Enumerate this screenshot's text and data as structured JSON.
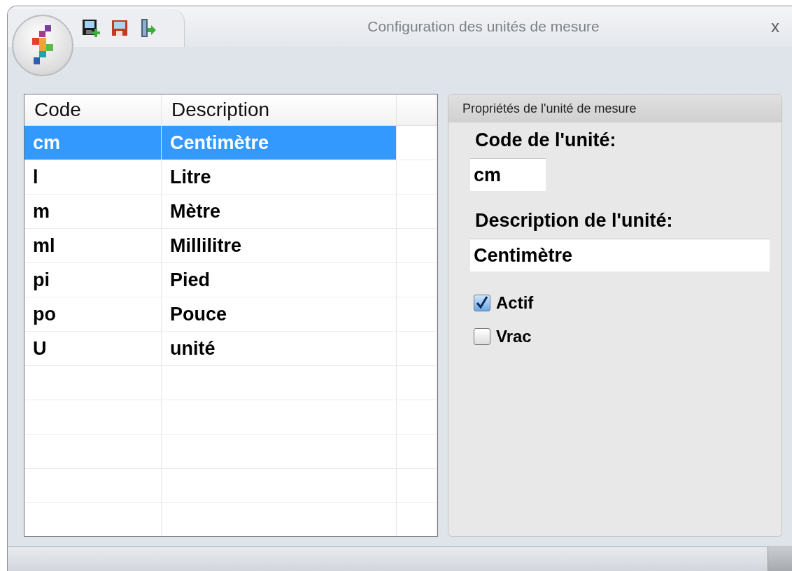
{
  "window": {
    "title": "Configuration des unités de mesure",
    "close": "x"
  },
  "table": {
    "columns": [
      "Code",
      "Description"
    ],
    "rows": [
      {
        "cells": [
          "cm",
          "Centimètre"
        ],
        "selected": true
      },
      {
        "cells": [
          "l",
          "Litre"
        ],
        "selected": false
      },
      {
        "cells": [
          "m",
          "Mètre"
        ],
        "selected": false
      },
      {
        "cells": [
          "ml",
          "Millilitre"
        ],
        "selected": false
      },
      {
        "cells": [
          "pi",
          "Pied"
        ],
        "selected": false
      },
      {
        "cells": [
          "po",
          "Pouce"
        ],
        "selected": false
      },
      {
        "cells": [
          "U",
          "unité"
        ],
        "selected": false
      }
    ]
  },
  "properties": {
    "title": "Propriétés de l'unité de mesure",
    "fields": [
      {
        "label": "Code de l'unité:",
        "value": "cm",
        "kind": "short"
      },
      {
        "label": "Description de l'unité:",
        "value": "Centimètre",
        "kind": "wide"
      }
    ],
    "checkboxes": [
      {
        "label": "Actif",
        "checked": true
      },
      {
        "label": "Vrac",
        "checked": false
      }
    ]
  }
}
